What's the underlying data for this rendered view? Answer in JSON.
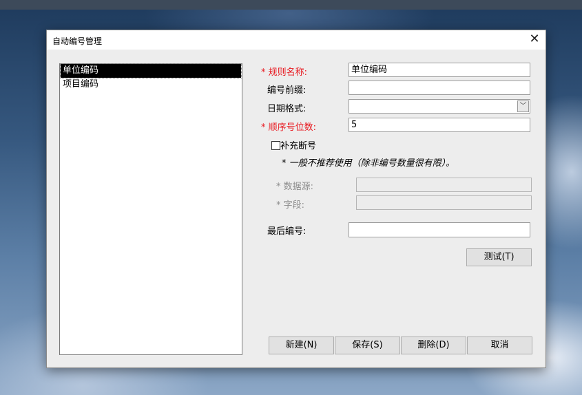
{
  "window": {
    "title": "自动编号管理"
  },
  "list": {
    "items": [
      "单位编码",
      "项目编码"
    ],
    "selected": "单位编码"
  },
  "form": {
    "rule_name": {
      "required_mark": "* ",
      "label": "规则名称:",
      "value": "单位编码"
    },
    "prefix": {
      "label": "编号前缀:",
      "value": ""
    },
    "date_format": {
      "label": "日期格式:",
      "value": ""
    },
    "seq_digits": {
      "required_mark": "* ",
      "label": "顺序号位数:",
      "value": "5"
    },
    "fill_gap": {
      "label": "补充断号",
      "checked": false
    },
    "note": "* 一般不推荐使用（除非编号数量很有限）。",
    "data_source": {
      "label": "* 数据源:",
      "value": ""
    },
    "field": {
      "label": "* 字段:",
      "value": ""
    },
    "last_number": {
      "label": "最后编号:",
      "value": ""
    }
  },
  "buttons": {
    "test": "测试(T)",
    "new": "新建(N)",
    "save": "保存(S)",
    "delete": "删除(D)",
    "cancel": "取消"
  },
  "icons": {
    "close": "close-icon",
    "dropdown": "chevron-down-icon"
  }
}
